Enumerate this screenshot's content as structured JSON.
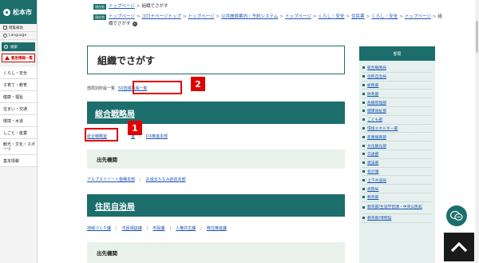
{
  "sidebar": {
    "logo": "松本市",
    "util_items": [
      "閲覧補助",
      "Language"
    ],
    "search_label": "検索",
    "emergency_label": "緊急情報一覧",
    "menu": [
      "くらし・安全",
      "子育て・教育",
      "健康・福祉",
      "住まい・交通",
      "環境・水道",
      "しごと・産業",
      "観光・文化・スポーツ",
      "基本情報"
    ]
  },
  "breadcrumbs": {
    "tag1": "現在地",
    "row1": [
      "トップページ",
      "組織でさがす"
    ],
    "tag2": "現在地",
    "row2_links": [
      "トップページ",
      "コロナページトップ",
      "トップページ",
      "公共施設案内・予約システム",
      "トップページ",
      "くらし・安全",
      "住民票",
      "くらし・安全",
      "トップページ"
    ],
    "row2_current": "組織でさがす",
    "close_glyph": "×"
  },
  "main": {
    "title": "組織でさがす",
    "list_label": "部局別所属一覧",
    "list_link": "50音順所属一覧",
    "sections": [
      {
        "heading": "総合戦略局",
        "links": [
          "総合戦略室",
          "室",
          "DX推進本部"
        ],
        "sub_heading": "出先機関",
        "sub_links": [
          "アルプスリゾート整備本部",
          "お城まちなみ創造本部"
        ]
      },
      {
        "heading": "住民自治局",
        "links": [
          "地域づくり課",
          "市民相談課",
          "市民課",
          "人権共生課",
          "移住推進課"
        ],
        "sub_heading": "出先機関"
      }
    ]
  },
  "annotations": {
    "a1": "1",
    "a2": "2"
  },
  "right_panel": {
    "heading": "部局",
    "items": [
      "総合戦略局",
      "住民自治局",
      "総務部",
      "財政部",
      "危機管理部",
      "健康福祉部",
      "こども部",
      "環境エネルギー部",
      "産業振興部",
      "文化観光部",
      "交通部",
      "建設部",
      "会計課",
      "上下水道局",
      "病院局",
      "教育部",
      "教育部/生涯学習課・中央公民館",
      "教育部/博物館"
    ]
  },
  "floating": {
    "chat_icon": "chat-bubble-icon",
    "top_icon": "chevron-up-icon"
  },
  "colors": {
    "brand": "#1b6e6b",
    "link": "#1a55b5",
    "annotation": "#e00000",
    "subbox": "#e9f2ea",
    "panel": "#e6f0ee"
  }
}
